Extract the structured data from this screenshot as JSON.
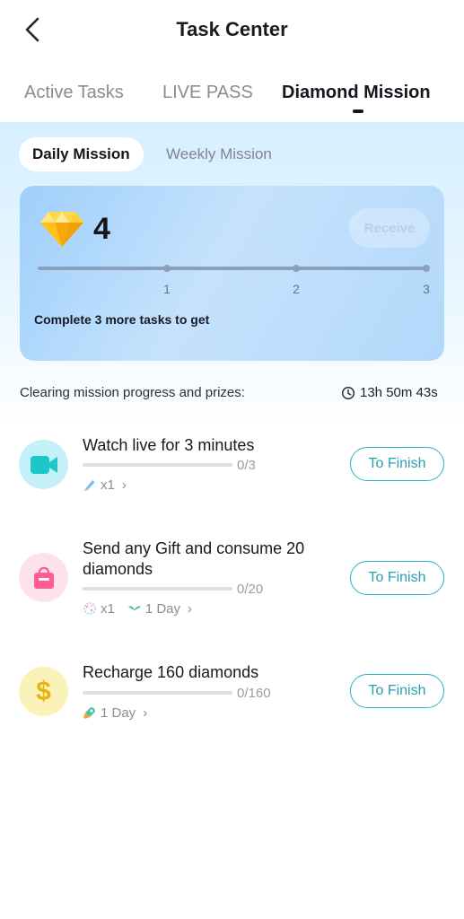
{
  "header": {
    "title": "Task Center"
  },
  "top_tabs": [
    {
      "label": "Active Tasks",
      "active": false
    },
    {
      "label": "LIVE PASS",
      "active": false
    },
    {
      "label": "Diamond Mission",
      "active": true
    }
  ],
  "sub_tabs": [
    {
      "label": "Daily Mission",
      "active": true
    },
    {
      "label": "Weekly Mission",
      "active": false
    }
  ],
  "reward_card": {
    "diamond_count": "4",
    "receive_label": "Receive",
    "receive_enabled": false,
    "milestones": [
      "1",
      "2",
      "3"
    ],
    "tasks_completed": 0,
    "hint": "Complete 3 more tasks to get"
  },
  "clearing": {
    "label": "Clearing mission progress and prizes:",
    "countdown": "13h 50m 43s"
  },
  "tasks": [
    {
      "title": "Watch live for 3 minutes",
      "progress": "0/3",
      "progress_fraction": 0,
      "icon": "video-camera-icon",
      "rewards": [
        {
          "icon": "marker-pen-icon",
          "text": "x1"
        }
      ],
      "button": "To Finish"
    },
    {
      "title": "Send any Gift and consume 20 diamonds",
      "progress": "0/20",
      "progress_fraction": 0,
      "icon": "gift-bag-icon",
      "rewards": [
        {
          "icon": "sparkle-badge-icon",
          "text": "x1"
        },
        {
          "icon": "wings-icon",
          "text": "1 Day"
        }
      ],
      "button": "To Finish"
    },
    {
      "title": "Recharge 160 diamonds",
      "progress": "0/160",
      "progress_fraction": 0,
      "icon": "dollar-coin-icon",
      "rewards": [
        {
          "icon": "rocket-icon",
          "text": "1 Day"
        }
      ],
      "button": "To Finish"
    }
  ],
  "colors": {
    "accent": "#2cb2c2",
    "video_icon_bg": "#c4f1f8",
    "gift_icon_bg": "#fde2ec",
    "coin_icon_bg": "#fbf2ba"
  }
}
